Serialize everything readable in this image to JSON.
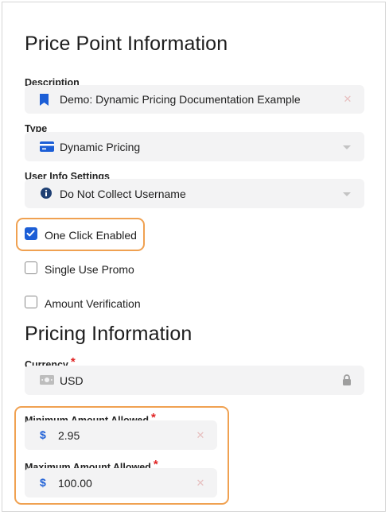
{
  "section_price_point": {
    "title": "Price Point Information"
  },
  "description": {
    "label": "Description",
    "value": "Demo: Dynamic Pricing Documentation Example",
    "icon": "bookmark-icon"
  },
  "type": {
    "label": "Type",
    "value": "Dynamic Pricing",
    "icon": "credit-card-icon"
  },
  "user_info": {
    "label": "User Info Settings",
    "value": "Do Not Collect Username",
    "icon": "info-icon"
  },
  "checkboxes": [
    {
      "label": "One Click Enabled",
      "checked": true
    },
    {
      "label": "Single Use Promo",
      "checked": false
    },
    {
      "label": "Amount Verification",
      "checked": false
    }
  ],
  "section_pricing": {
    "title": "Pricing Information"
  },
  "currency": {
    "label": "Currency",
    "required_mark": "*",
    "value": "USD",
    "icon": "money-icon",
    "lock_icon": "lock-icon"
  },
  "min_amount": {
    "label": "Minimum Amount Allowed",
    "required_mark": "*",
    "prefix": "$",
    "value": "2.95"
  },
  "max_amount": {
    "label": "Maximum Amount Allowed",
    "required_mark": "*",
    "prefix": "$",
    "value": "100.00"
  },
  "colors": {
    "accent": "#1c5ed6",
    "highlight": "#f0a151",
    "required": "#e02424",
    "field_bg": "#f3f3f4"
  }
}
